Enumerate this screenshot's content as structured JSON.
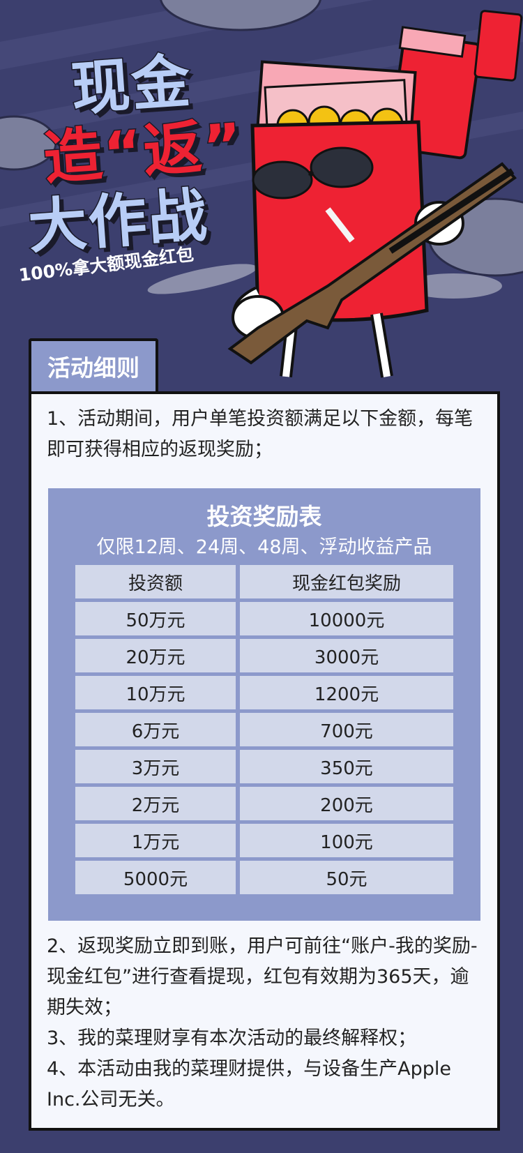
{
  "hero": {
    "title_line1": "现金",
    "title_line2": "造“返”",
    "title_line3": "大作战",
    "subtitle": "100%拿大额现金红包"
  },
  "section_tab": "活动细则",
  "rules": {
    "p1": "1、活动期间，用户单笔投资额满足以下金额，每笔即可获得相应的返现奖励；",
    "p2": "2、返现奖励立即到账，用户可前往“账户-我的奖励-现金红包”进行查看提现，红包有效期为365天，逾期失效；",
    "p3": "3、我的菜理财享有本次活动的最终解释权；",
    "p4": "4、本活动由我的菜理财提供，与设备生产Apple Inc.公司无关。"
  },
  "table": {
    "title": "投资奖励表",
    "subtitle": "仅限12周、24周、48周、浮动收益产品",
    "headers": [
      "投资额",
      "现金红包奖励"
    ],
    "rows": [
      [
        "50万元",
        "10000元"
      ],
      [
        "20万元",
        "3000元"
      ],
      [
        "10万元",
        "1200元"
      ],
      [
        "6万元",
        "700元"
      ],
      [
        "3万元",
        "350元"
      ],
      [
        "2万元",
        "200元"
      ],
      [
        "1万元",
        "100元"
      ],
      [
        "5000元",
        "50元"
      ]
    ]
  },
  "colors": {
    "background": "#3c3f6e",
    "accent_blue": "#8c99cb",
    "envelope_red": "#ee2233",
    "title_blue": "#b8cdf6"
  }
}
